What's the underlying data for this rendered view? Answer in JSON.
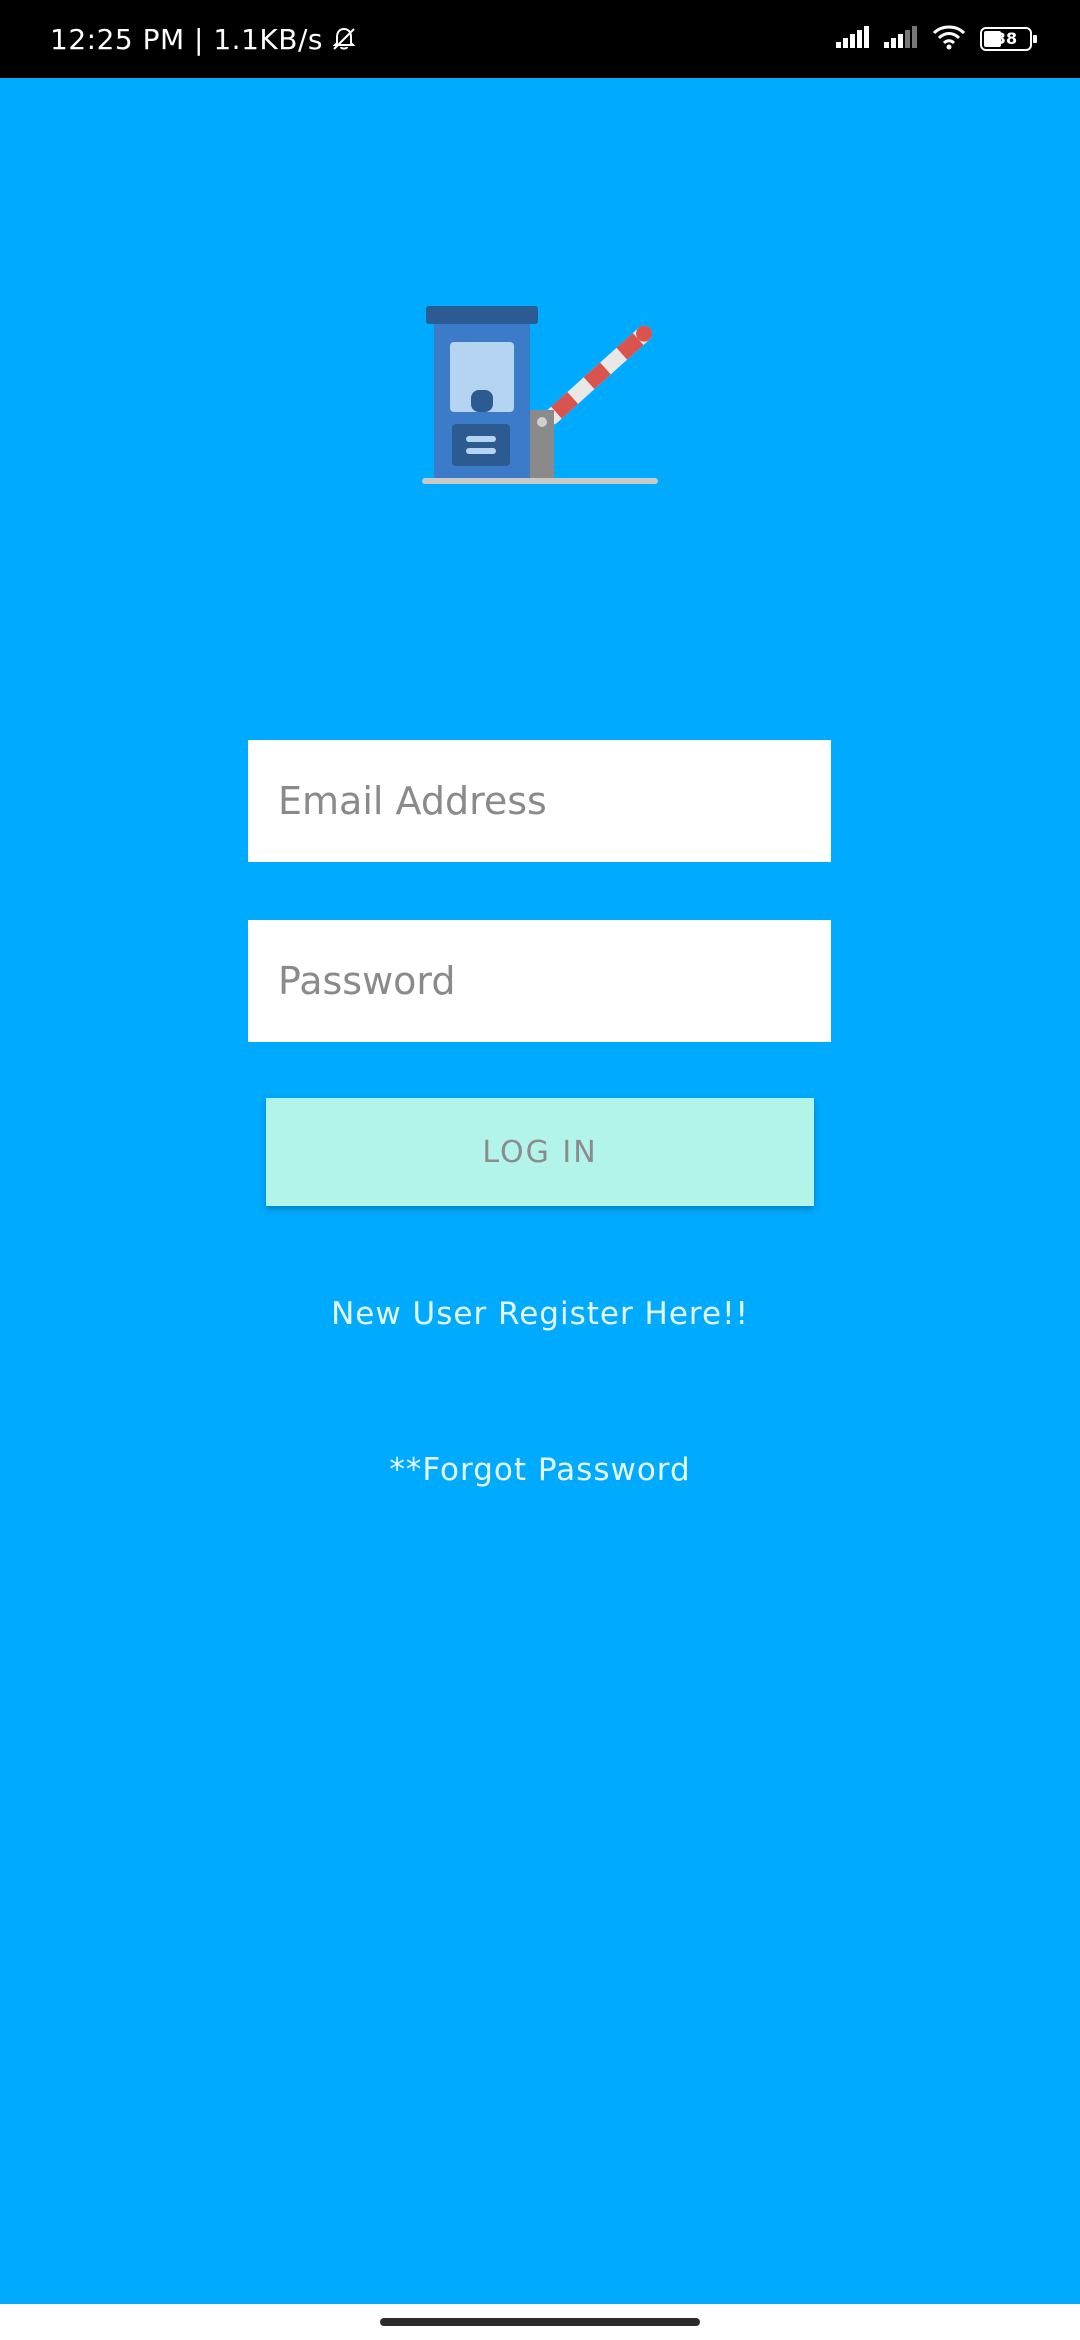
{
  "status_bar": {
    "time_speed": "12:25 PM | 1.1KB/s",
    "battery_level": "38",
    "icons": [
      "bell-off-icon",
      "signal-icon",
      "signal-icon",
      "wifi-icon",
      "battery-icon"
    ]
  },
  "logo": {
    "icon": "toll-booth-barrier-icon",
    "colors": {
      "booth": "#3C7BC8",
      "booth_roof": "#2B5B91",
      "window": "#B4D4F2",
      "barrier_red": "#D9534F",
      "barrier_white": "#E8E8E8",
      "post": "#8A8A8A",
      "ground": "#C9C9C9"
    }
  },
  "login_form": {
    "email_placeholder": "Email Address",
    "password_placeholder": "Password",
    "login_label": "LOG IN"
  },
  "links": {
    "register": "New User Register Here!!",
    "forgot": "**Forgot Password"
  },
  "theme": {
    "background": "#00AAFF",
    "button_bg": "#B2F4EA",
    "link_color": "#E4F7FF"
  }
}
